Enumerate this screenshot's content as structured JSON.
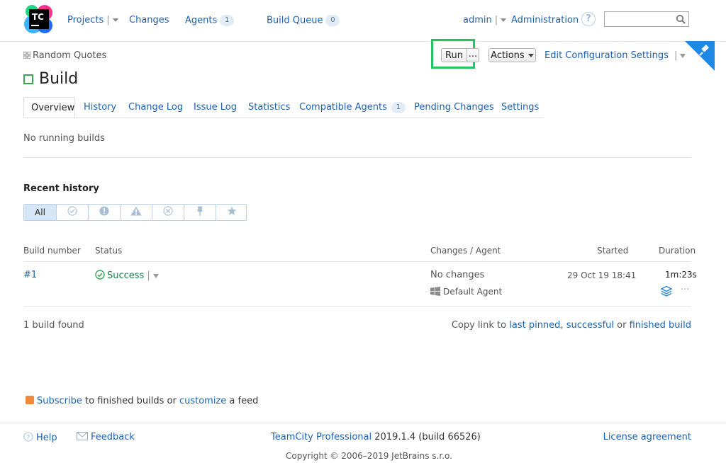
{
  "header": {
    "logo_text": "TC",
    "nav": {
      "projects": "Projects",
      "changes": "Changes",
      "agents": "Agents",
      "agents_count": "1",
      "build_queue": "Build Queue",
      "build_queue_count": "0"
    },
    "user": "admin",
    "administration": "Administration",
    "help_glyph": "?",
    "search_value": ""
  },
  "breadcrumb": {
    "project": "Random Quotes"
  },
  "title": "Build",
  "toolbar": {
    "run_label": "Run",
    "run_more_label": "...",
    "actions_label": "Actions",
    "edit_config_label": "Edit Configuration Settings"
  },
  "tabs": [
    {
      "label": "Overview"
    },
    {
      "label": "History"
    },
    {
      "label": "Change Log"
    },
    {
      "label": "Issue Log"
    },
    {
      "label": "Statistics"
    },
    {
      "label": "Compatible Agents",
      "count": "1"
    },
    {
      "label": "Pending Changes"
    },
    {
      "label": "Settings"
    }
  ],
  "no_running_builds": "No running builds",
  "recent_history": {
    "title": "Recent history",
    "filters": [
      {
        "label": "All",
        "icon": ""
      },
      {
        "label": "",
        "icon": "success-filter-icon"
      },
      {
        "label": "",
        "icon": "failed-filter-icon"
      },
      {
        "label": "",
        "icon": "warning-filter-icon"
      },
      {
        "label": "",
        "icon": "cancelled-filter-icon"
      },
      {
        "label": "",
        "icon": "pin-filter-icon"
      },
      {
        "label": "",
        "icon": "star-filter-icon"
      }
    ]
  },
  "table": {
    "headers": {
      "build_number": "Build number",
      "status": "Status",
      "changes_agent": "Changes / Agent",
      "started": "Started",
      "duration": "Duration"
    },
    "rows": [
      {
        "build_number": "#1",
        "status": "Success",
        "changes": "No changes",
        "agent": "Default Agent",
        "started": "29 Oct 19 18:41",
        "duration": "1m:23s",
        "more": "···"
      }
    ]
  },
  "builds_found": "1 build found",
  "copy_link": {
    "prefix": "Copy link to",
    "last_pinned": "last pinned",
    "comma": ",",
    "successful": "successful",
    "or": "or",
    "finished_build": "finished build"
  },
  "subscribe": {
    "subscribe_link": "Subscribe",
    "middle": "to finished builds or",
    "customize_link": "customize",
    "suffix": "a feed"
  },
  "footer": {
    "help": "Help",
    "feedback": "Feedback",
    "product": "TeamCity Professional",
    "version": "2019.1.4 (build 66526)",
    "license": "License agreement",
    "copyright": "Copyright © 2006–2019 JetBrains s.r.o."
  },
  "colors": {
    "link": "#1c61b1",
    "success": "#34a853",
    "highlight": "#22c55e",
    "ribbon": "#1e88e5"
  }
}
